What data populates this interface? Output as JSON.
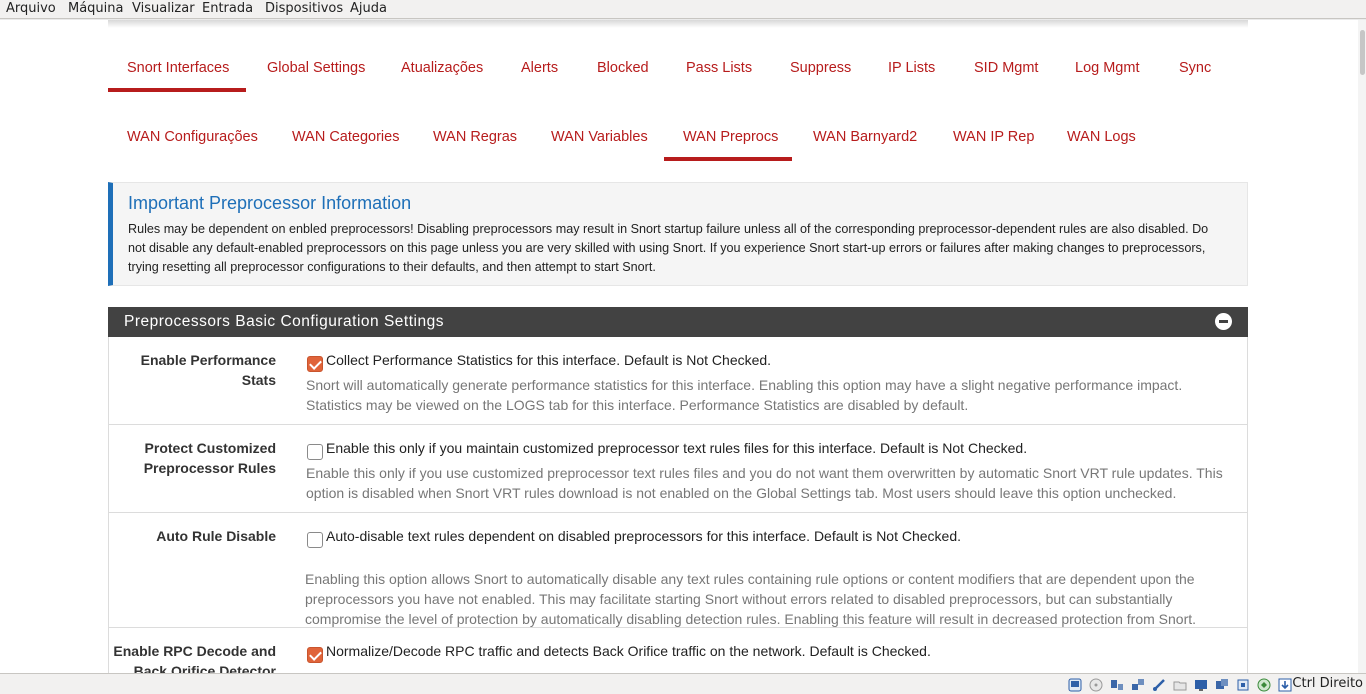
{
  "vbox_menu": [
    "Arquivo",
    "Máquina",
    "Visualizar",
    "Entrada",
    "Dispositivos",
    "Ajuda"
  ],
  "main_tabs": [
    "Snort Interfaces",
    "Global Settings",
    "Atualizações",
    "Alerts",
    "Blocked",
    "Pass Lists",
    "Suppress",
    "IP Lists",
    "SID Mgmt",
    "Log Mgmt",
    "Sync"
  ],
  "main_tab_active": "Snort Interfaces",
  "sub_tabs": [
    "WAN Configurações",
    "WAN Categories",
    "WAN Regras",
    "WAN Variables",
    "WAN Preprocs",
    "WAN Barnyard2",
    "WAN IP Rep",
    "WAN Logs"
  ],
  "sub_tab_active": "WAN Preprocs",
  "info": {
    "title": "Important Preprocessor Information",
    "text": "Rules may be dependent on enbled preprocessors! Disabling preprocessors may result in Snort startup failure unless all of the corresponding preprocessor-dependent rules are also disabled. Do not disable any default-enabled preprocessors on this page unless you are very skilled with using Snort. If you experience Snort start-up errors or failures after making changes to preprocessors, trying resetting all preprocessor configurations to their defaults, and then attempt to start Snort."
  },
  "panel": {
    "title": "Preprocessors Basic Configuration Settings",
    "rows": [
      {
        "label": "Enable Performance Stats",
        "checked": true,
        "checkbox_text": "Collect Performance Statistics for this interface. Default is Not Checked.",
        "help": "Snort will automatically generate performance statistics for this interface. Enabling this option may have a slight negative performance impact. Statistics may be viewed on the LOGS tab for this interface. Performance Statistics are disabled by default."
      },
      {
        "label": "Protect Customized Preprocessor Rules",
        "checked": false,
        "checkbox_text": "Enable this only if you maintain customized preprocessor text rules files for this interface. Default is Not Checked.",
        "help": "Enable this only if you use customized preprocessor text rules files and you do not want them overwritten by automatic Snort VRT rule updates. This option is disabled when Snort VRT rules download is not enabled on the Global Settings tab. Most users should leave this option unchecked."
      },
      {
        "label": "Auto Rule Disable",
        "checked": false,
        "checkbox_text": "Auto-disable text rules dependent on disabled preprocessors for this interface. Default is Not Checked.",
        "help": "Enabling this option allows Snort to automatically disable any text rules containing rule options or content modifiers that are dependent upon the preprocessors you have not enabled. This may facilitate starting Snort without errors related to disabled preprocessors, but can substantially compromise the level of protection by automatically disabling detection rules. Enabling this feature will result in decreased protection from Snort."
      },
      {
        "label": "Enable RPC Decode and Back Orifice Detector",
        "checked": true,
        "checkbox_text": "Normalize/Decode RPC traffic and detects Back Orifice traffic on the network. Default is Checked.",
        "help": ""
      }
    ]
  },
  "statusbar": {
    "host_key": "Ctrl Direito",
    "icons": [
      "hard-disk-icon",
      "optical-drive-icon",
      "audio-icon",
      "network-icon",
      "usb-icon",
      "shared-folder-icon",
      "display-icon",
      "video-capture-icon",
      "cpu-icon",
      "mouse-integration-icon",
      "keyboard-capture-icon"
    ]
  }
}
